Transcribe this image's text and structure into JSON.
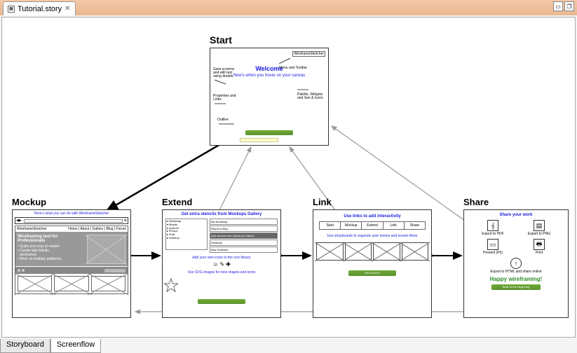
{
  "tab": {
    "filename": "Tutorial.story"
  },
  "bottom_tabs": {
    "storyboard": "Storyboard",
    "screenflow": "Screenflow"
  },
  "nodes": {
    "start": {
      "title": "Start",
      "app_label": "WireframeSketcher",
      "welcome": "Welcome",
      "subtitle": "Now's when you\nhover on your\ncanvas",
      "ann_toolbar": "Menu and\nToolbar",
      "ann_drag": "Save screens\nand edit text\nusing double",
      "ann_props": "Properties and\nLinks",
      "ann_palette": "Palette,\nWidgets and\nSee & Icons",
      "ann_outline": "Outline"
    },
    "mockup": {
      "title": "Mockup",
      "header": "Here's what you can do with WireframeSketcher",
      "app_label": "WireframeSketcher",
      "hero_title": "Wireframing tool for\nProfessionals",
      "nav": "Home | About | Gallery | Blog | Forum"
    },
    "extend": {
      "title": "Extend",
      "header": "Get extra stencils from Mockups Gallery",
      "tree": [
        "▸ Bootstrap",
        "▾ Mobile",
        "  ▸ Android",
        "  ▸ iPhone",
        "  ▸ iPad",
        "▸ Desktop"
      ],
      "list": [
        "My Bootstrap",
        "Report a Bug",
        "Add stencils from Mockups Gallery",
        "Windows",
        "Mac Software"
      ],
      "sub1": "Add your own icons to the Icon library",
      "sub2": "Use SVG images for new shapes and icons"
    },
    "link": {
      "title": "Link",
      "header": "Use links to add interactivity",
      "buttons": [
        "Start",
        "Mockup",
        "Extend",
        "Link",
        "Share"
      ],
      "sub": "Use storyboards to organize user stories\nand screen flows",
      "btn_label": "Next screen"
    },
    "share": {
      "title": "Share",
      "header": "Share your work",
      "items": [
        {
          "icon": "⎘",
          "label": "Export to PDF"
        },
        {
          "icon": "🖼",
          "label": "Export to PNG"
        },
        {
          "icon": "▭",
          "label": "Present (F5)"
        },
        {
          "icon": "🖶",
          "label": "Print"
        }
      ],
      "full": {
        "icon": "⬆",
        "label": "Export to HTML\nand share online"
      },
      "happy": "Happy wireframing!",
      "back": "Back to the beginning"
    }
  }
}
